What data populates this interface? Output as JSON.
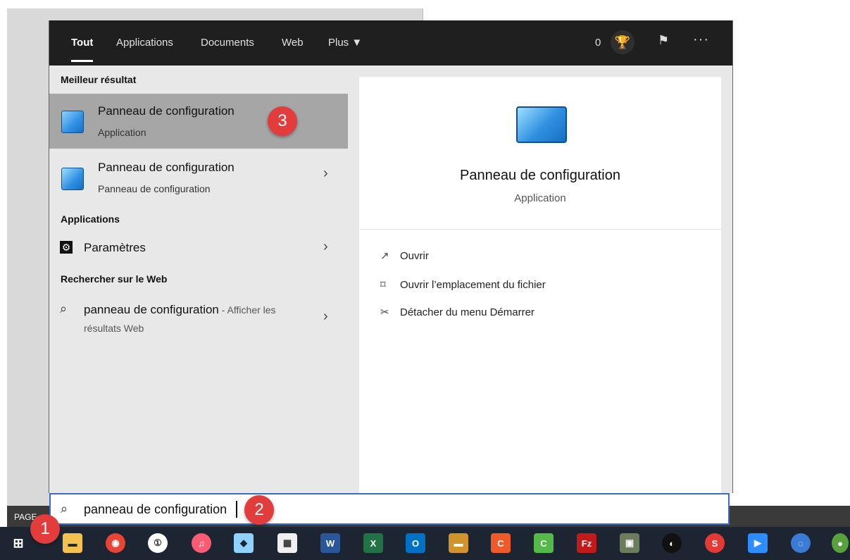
{
  "background": {
    "page_label": "PAGE"
  },
  "topbar": {
    "tabs": [
      "Tout",
      "Applications",
      "Documents",
      "Web",
      "Plus ▼"
    ],
    "active_tab": "Tout",
    "points": "0"
  },
  "left": {
    "best_header": "Meilleur résultat",
    "best_title": "Panneau de configuration",
    "best_sub": "Application",
    "second_title": "Panneau de configuration",
    "second_sub": "Panneau de configuration",
    "apps_header": "Applications",
    "app_item": "Paramètres",
    "web_header": "Rechercher sur le Web",
    "web_query": "panneau de configuration",
    "web_suffix": " - Afficher les",
    "web_line2": "résultats Web"
  },
  "right": {
    "title": "Panneau de configuration",
    "subtitle": "Application",
    "actions": [
      "Ouvrir",
      "Ouvrir l’emplacement du fichier",
      "Détacher du menu Démarrer"
    ]
  },
  "search": {
    "query": "panneau de configuration"
  },
  "badges": [
    "1",
    "2",
    "3"
  ],
  "colors": {
    "accent_badge": "#e23c3c",
    "topbar": "#1f1f1f",
    "taskbar": "#1d2533"
  }
}
